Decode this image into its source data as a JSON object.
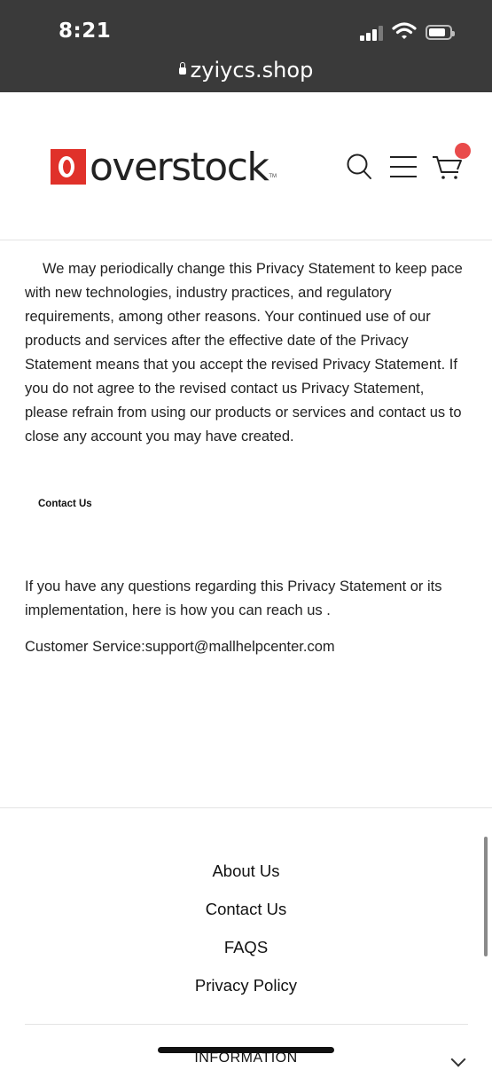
{
  "status_bar": {
    "time": "8:21"
  },
  "browser": {
    "url": "zyiycs.shop"
  },
  "header": {
    "logo_text": "overstock",
    "logo_tm": "TM",
    "icons": [
      "search-icon",
      "menu-icon",
      "cart-icon"
    ]
  },
  "content": {
    "paragraph1": "We may periodically change this Privacy Statement to keep pace with new technologies, industry practices, and regulatory requirements, among other reasons.  Your continued use of our products and services after the effective date of the Privacy Statement means that you accept the revised Privacy Statement. If you do not agree to the revised contact us Privacy Statement, please refrain from using our products or services and contact us  to close any account you may have created.",
    "contact_heading": "Contact Us",
    "paragraph2": "If you have any questions regarding this Privacy Statement or its implementation, here is how you can reach us .",
    "customer_service": "Customer Service:support@mallhelpcenter.com"
  },
  "footer": {
    "links": [
      "About Us",
      "Contact Us",
      "FAQS",
      "Privacy Policy"
    ],
    "information_label": "INFORMATION"
  },
  "colors": {
    "status_bar_bg": "#3a3a3a",
    "brand_red": "#e0312a",
    "cart_badge": "#e94b4b"
  }
}
